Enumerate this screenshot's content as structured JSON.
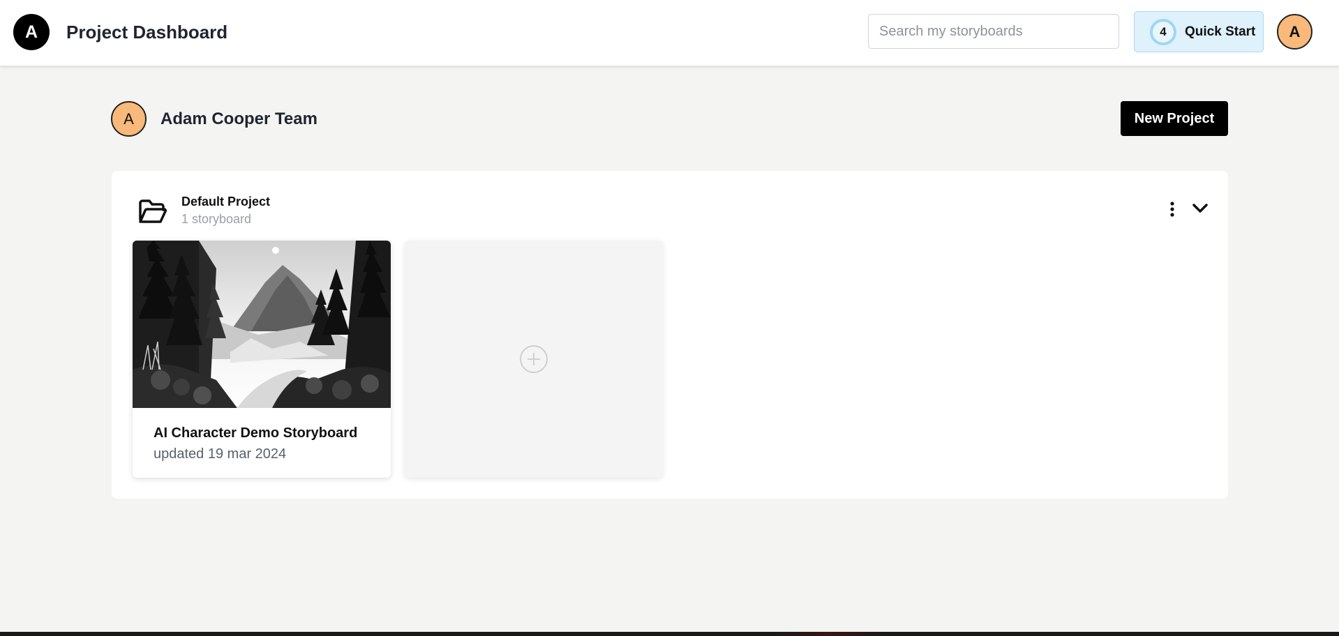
{
  "header": {
    "logo_letter": "A",
    "title": "Project Dashboard",
    "search_placeholder": "Search my storyboards",
    "quick_start": {
      "count": "4",
      "label": "Quick Start"
    },
    "user_avatar_letter": "A"
  },
  "team": {
    "avatar_letter": "A",
    "name": "Adam Cooper Team",
    "new_project_label": "New Project"
  },
  "project": {
    "name": "Default Project",
    "storyboard_count": "1 storyboard",
    "icons": [
      "folder-open-icon",
      "more-vertical-icon",
      "chevron-down-icon"
    ],
    "cards": [
      {
        "title": "AI Character Demo Storyboard",
        "updated": "updated 19 mar 2024"
      }
    ],
    "add_card_icon": "plus-circle-icon"
  },
  "colors": {
    "page_bg": "#f4f4f2",
    "avatar_bg": "#f8b97a",
    "quick_start_bg": "#dff1fb",
    "primary_button": "#000000"
  }
}
